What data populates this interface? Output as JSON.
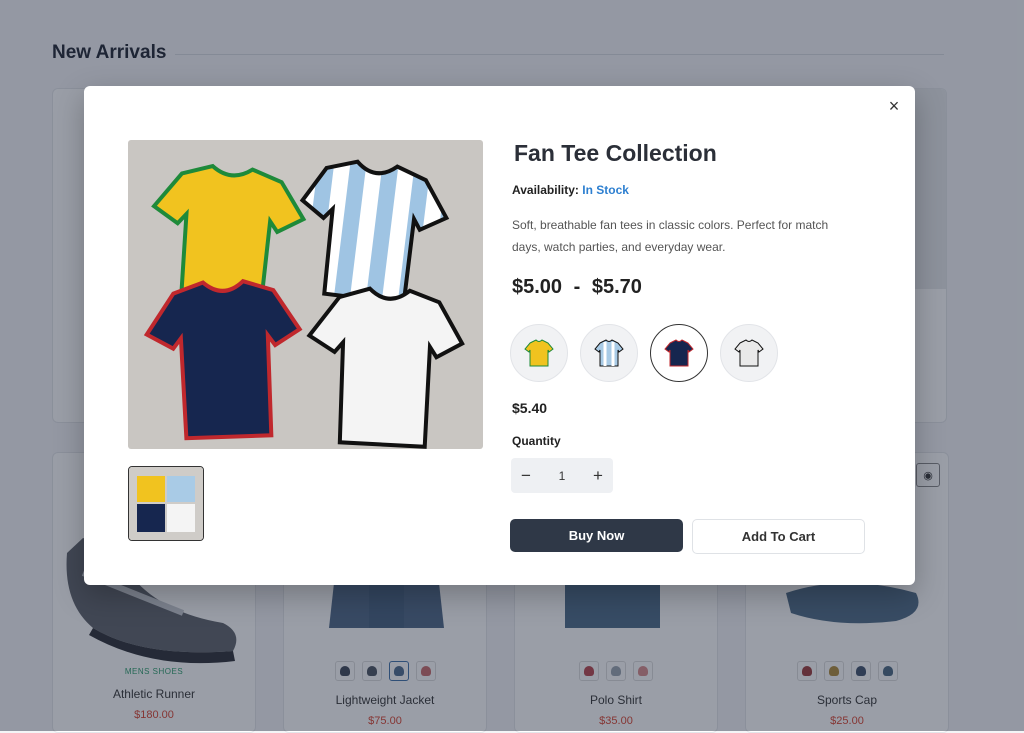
{
  "page": {
    "section_title": "New Arrivals",
    "eye_icon": "eye-icon"
  },
  "cards": [
    {
      "category": "MENS SHOES",
      "name": "Athletic Runner",
      "price": "$180.00"
    },
    {
      "name": "Lightweight Jacket",
      "price": "$75.00",
      "swatches": [
        "#3d4657",
        "#4a5260",
        "#4b6a8c",
        "#c96a6a"
      ]
    },
    {
      "name": "Polo Shirt",
      "price": "$35.00",
      "swatches": [
        "#b8444c",
        "#9aa4b0",
        "#d98a8a"
      ]
    },
    {
      "name": "Sports Cap",
      "price": "$25.00",
      "swatches": [
        "#9c3a3a",
        "#b08a3a",
        "#3d4f6a",
        "#4a6780"
      ]
    }
  ],
  "modal": {
    "close_icon": "×",
    "title": "Fan Tee Collection",
    "availability_label": "Availability:",
    "availability_value": "In Stock",
    "description": "Soft, breathable fan tees in classic colors. Perfect for match days, watch parties, and everyday wear.",
    "price_min": "$5.00",
    "price_sep": "-",
    "price_max": "$5.70",
    "variants": [
      {
        "color": "#f0c21c",
        "trim": "#1e8a3a"
      },
      {
        "color": "#a9cbe6",
        "trim": "#111111"
      },
      {
        "color": "#16264f",
        "trim": "#c0282d"
      },
      {
        "color": "#f3f3f3",
        "trim": "#111111"
      }
    ],
    "selected_variant": 2,
    "selected_price": "$5.40",
    "quantity_label": "Quantity",
    "quantity_value": "1",
    "minus": "−",
    "plus": "+",
    "buy_now": "Buy Now",
    "add_to_cart": "Add To Cart"
  }
}
